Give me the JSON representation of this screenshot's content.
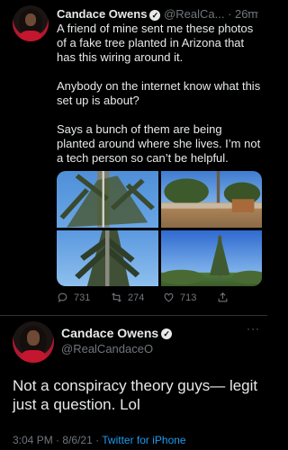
{
  "tweet1": {
    "name": "Candace Owens",
    "handle": "@RealCa...",
    "separator": "·",
    "time": "26m",
    "more": "···",
    "text": [
      "A friend of mine sent me these photos of a fake tree planted in Arizona that has this wiring around it.",
      "Anybody on the internet know what this set up is about?",
      "Says a bunch of them are being planted around where she lives. I’m not a tech person so can’t be helpful."
    ],
    "actions": {
      "replies": "731",
      "retweets": "274",
      "likes": "713"
    }
  },
  "tweet2": {
    "name": "Candace Owens",
    "handle": "@RealCandaceO",
    "more": "···",
    "text": "Not a conspiracy theory guys— legit just a question. Lol",
    "time": "3:04 PM",
    "dot1": "·",
    "date": "8/6/21",
    "dot2": "·",
    "source": "Twitter for iPhone"
  },
  "colors": {
    "background": "#000000",
    "text": "#e7e9ea",
    "secondary": "#71767b",
    "link": "#1d9bf0",
    "divider": "#2f3336"
  },
  "icons": [
    "reply-icon",
    "retweet-icon",
    "like-icon",
    "share-icon",
    "verified-badge-icon",
    "more-icon"
  ]
}
